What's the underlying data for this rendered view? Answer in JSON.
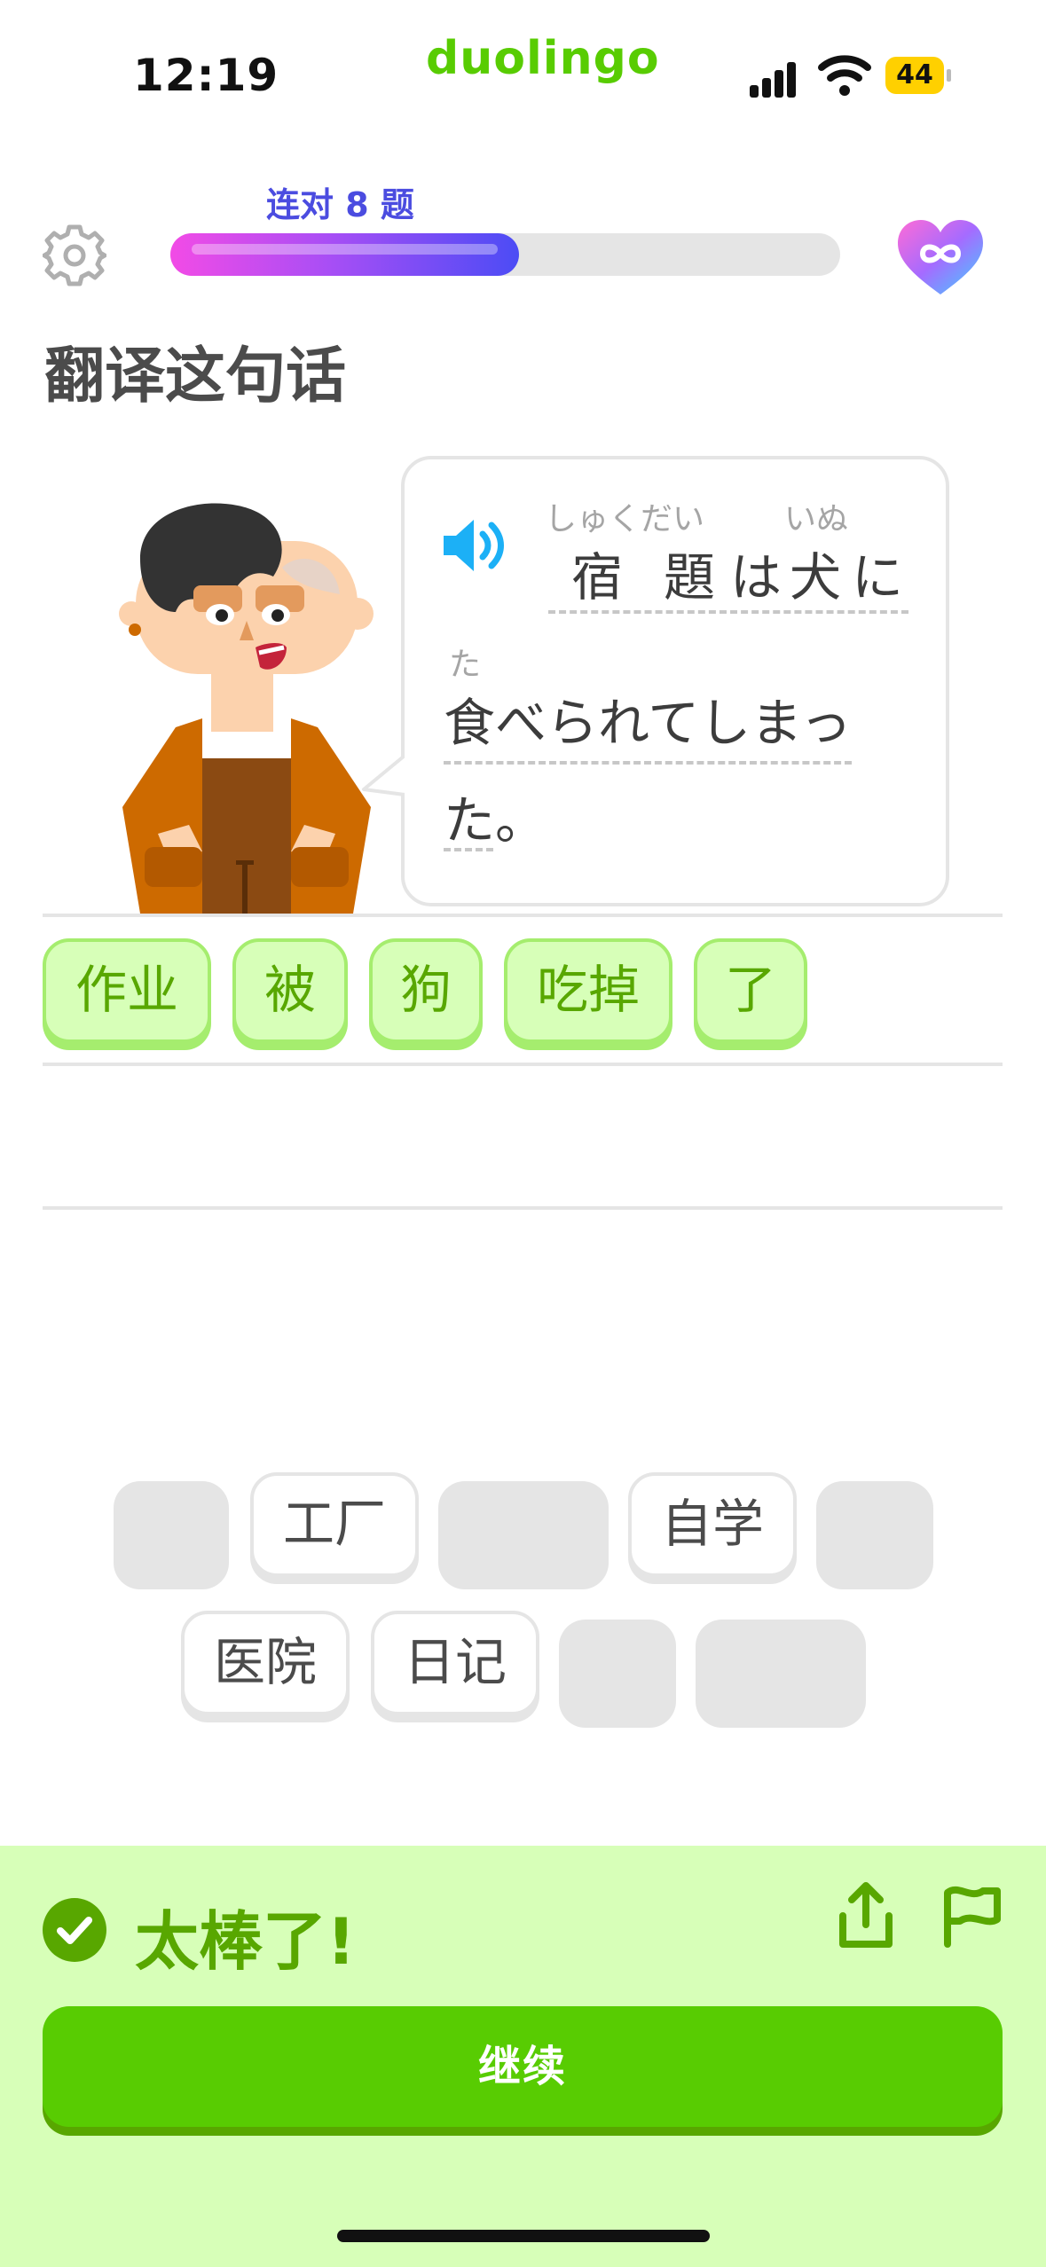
{
  "status_bar": {
    "time": "12:19",
    "brand": "duolingo",
    "battery": "44",
    "icons": [
      "signal-icon",
      "wifi-icon",
      "battery-icon"
    ]
  },
  "header": {
    "streak": "连对 8 题",
    "progress_fraction": 0.52,
    "icons": [
      "gear-icon",
      "infinite-heart-icon"
    ]
  },
  "instruction": "翻译这句话",
  "prompt": {
    "icon": "speaker-icon",
    "line1": {
      "furigana_1": "しゅくだい",
      "furigana_2": "いぬ",
      "kanji_1": "宿",
      "kanji_2": "題",
      "kana_1": "は",
      "kanji_3": "犬",
      "kana_2": "に"
    },
    "line2": {
      "furigana": "た",
      "text": "食べられてしまっ"
    },
    "line3": {
      "text": "た。"
    }
  },
  "answer_tiles": [
    "作业",
    "被",
    "狗",
    "吃掉",
    "了"
  ],
  "word_bank": {
    "row1": [
      "",
      "工厂",
      "",
      "自学",
      ""
    ],
    "row2": [
      "医院",
      "日记",
      "",
      ""
    ]
  },
  "feedback": {
    "message": "太棒了!",
    "continue_label": "继续",
    "icons": [
      "check-icon",
      "share-icon",
      "flag-icon"
    ]
  },
  "colors": {
    "green": "#58cc02",
    "dark_green": "#58a700",
    "light_green": "#d7ffb8",
    "progress_start": "#f24be6",
    "progress_end": "#4c4cf5",
    "streak_blue": "#4b4ce0"
  }
}
